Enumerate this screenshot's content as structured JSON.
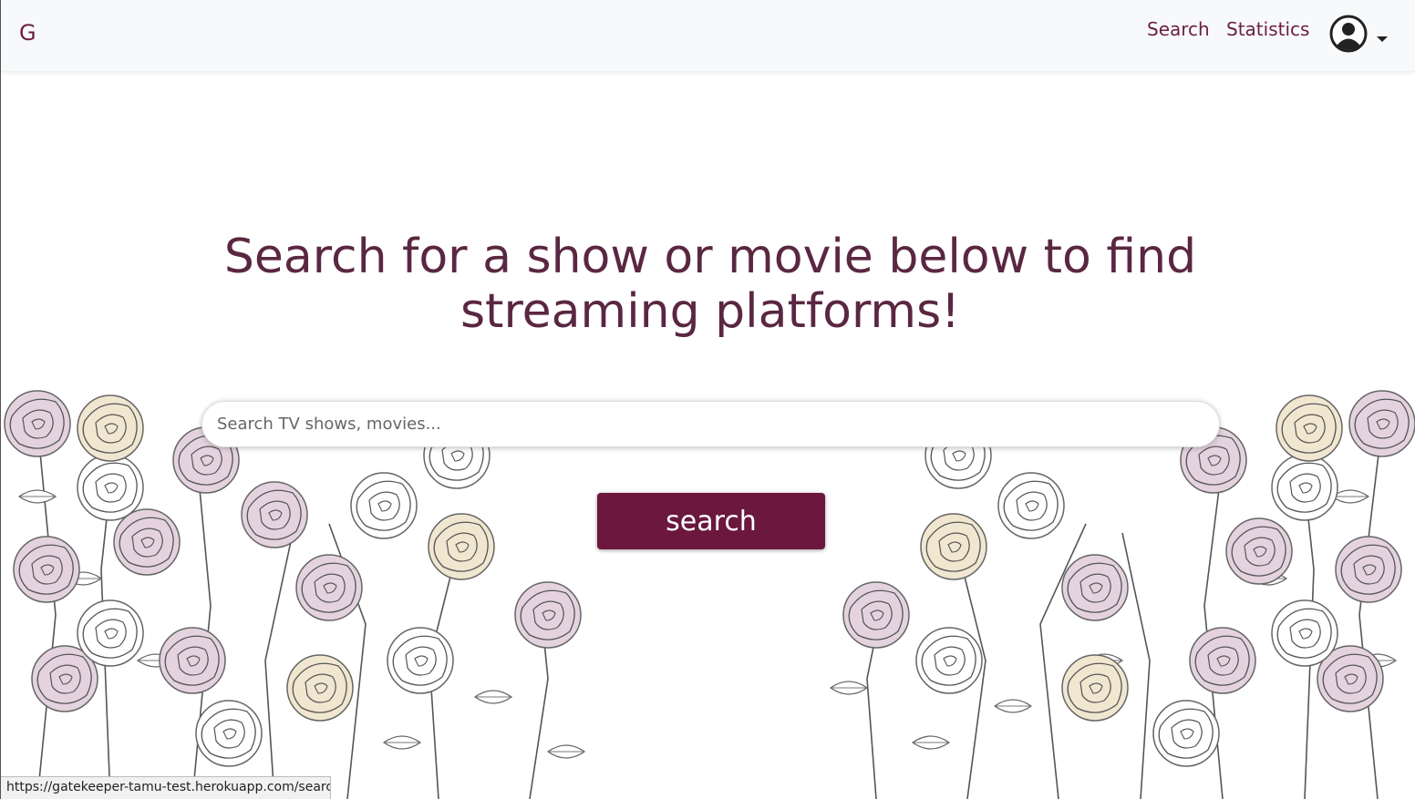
{
  "navbar": {
    "brand": "G",
    "links": [
      {
        "label": "Search"
      },
      {
        "label": "Statistics"
      }
    ],
    "user_icon": "user-circle-icon"
  },
  "main": {
    "headline": "Search for a show or movie below to find streaming platforms!",
    "search_placeholder": "Search TV shows, movies...",
    "search_button": "search"
  },
  "status_bar": {
    "url": "https://gatekeeper-tamu-test.herokuapp.com/search"
  },
  "colors": {
    "accent": "#6b173e",
    "headline": "#5a2742",
    "navbar_bg": "#f8f9fa",
    "rose_pink": "#e4d3df",
    "rose_cream": "#f1e6d0"
  }
}
